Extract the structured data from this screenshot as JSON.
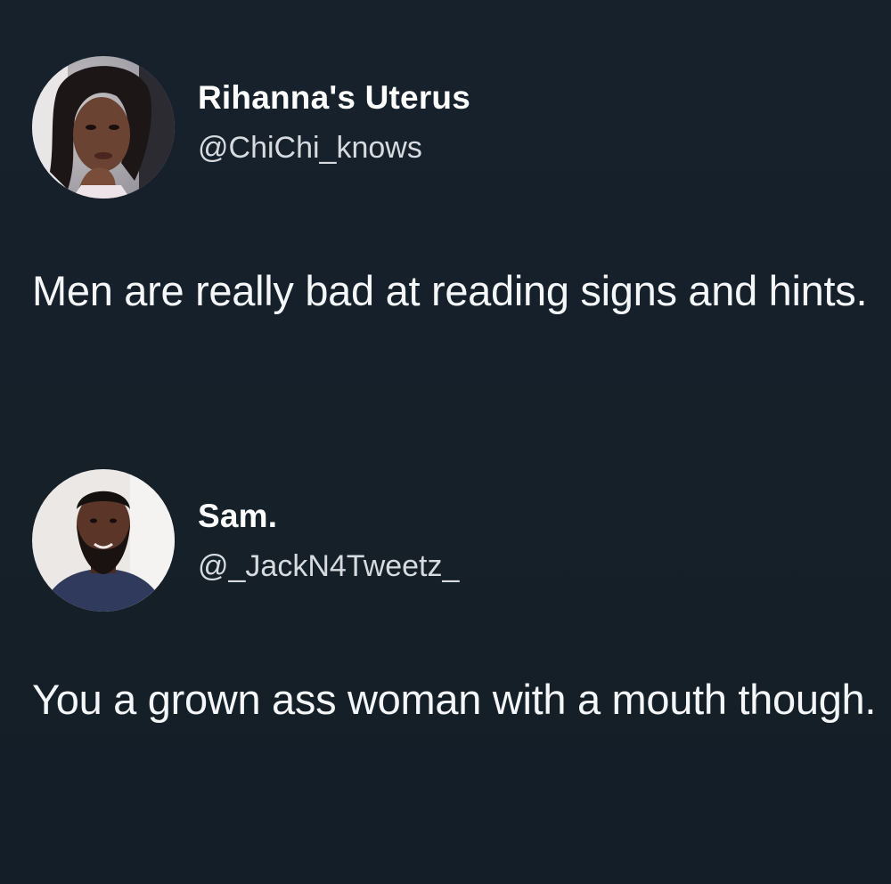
{
  "tweets": [
    {
      "display_name": "Rihanna's Uterus",
      "handle": "@ChiChi_knows",
      "text": "Men are really bad at reading signs and hints.",
      "avatar_icon": "profile-photo-woman"
    },
    {
      "display_name": "Sam.",
      "handle": "@_JackN4Tweetz_",
      "text": "You a grown ass woman with a mouth though.",
      "avatar_icon": "profile-photo-man"
    }
  ],
  "colors": {
    "background": "#15202b",
    "text": "#ffffff",
    "handle": "#d6dbe0"
  }
}
